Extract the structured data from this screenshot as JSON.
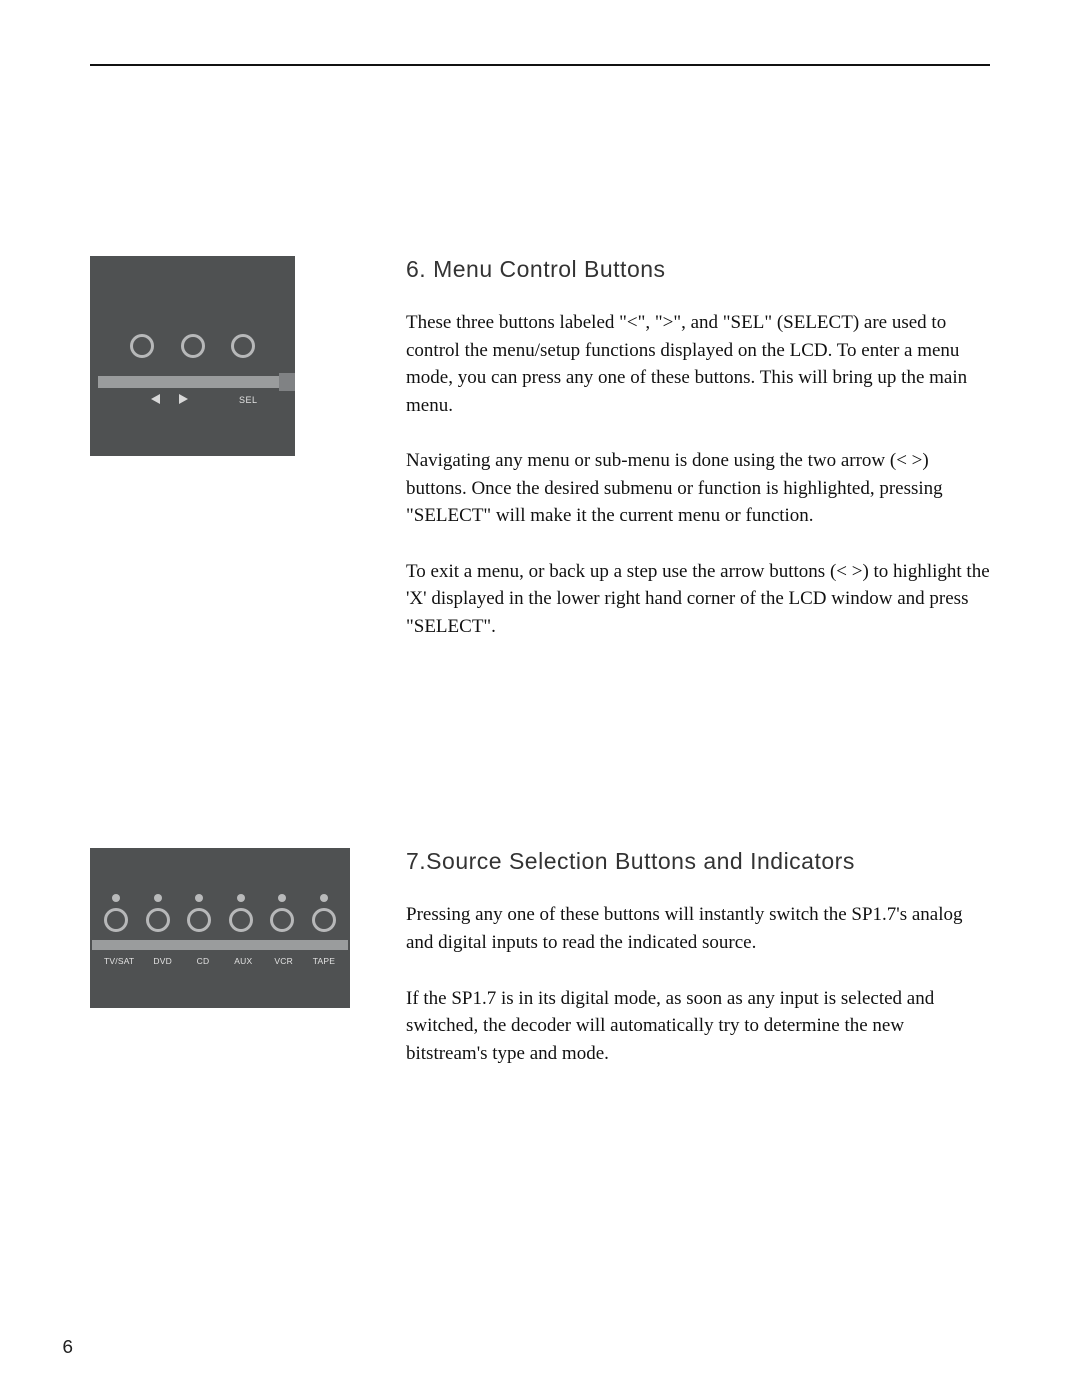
{
  "page_number": "6",
  "section6": {
    "heading": "6. Menu Control Buttons",
    "p1": "These three buttons labeled \"<\", \">\", and \"SEL\" (SELECT) are used to control the menu/setup functions displayed on the LCD. To enter a menu mode, you can press any one of these buttons. This will bring up the main menu.",
    "p2": "Navigating any menu or sub-menu is done using the two arrow (< >) buttons.  Once the desired submenu or function is highlighted, pressing \"SELECT\" will make it the current menu or function.",
    "p3": "To exit a menu, or back up a step use the arrow buttons (< >) to highlight the 'X' displayed in the lower right hand corner of the LCD window and press \"SELECT\".",
    "figure": {
      "sel_label": "SEL"
    }
  },
  "section7": {
    "heading": "7.Source Selection Buttons and Indicators",
    "p1": "Pressing any one of these buttons will instantly switch the SP1.7's analog and digital inputs to read the indicated source.",
    "p2": "If the SP1.7 is in its digital mode, as soon as any input is selected and switched, the decoder will automatically try to determine the new bitstream's type and mode.",
    "sources": [
      "TV/SAT",
      "DVD",
      "CD",
      "AUX",
      "VCR",
      "TAPE"
    ]
  }
}
